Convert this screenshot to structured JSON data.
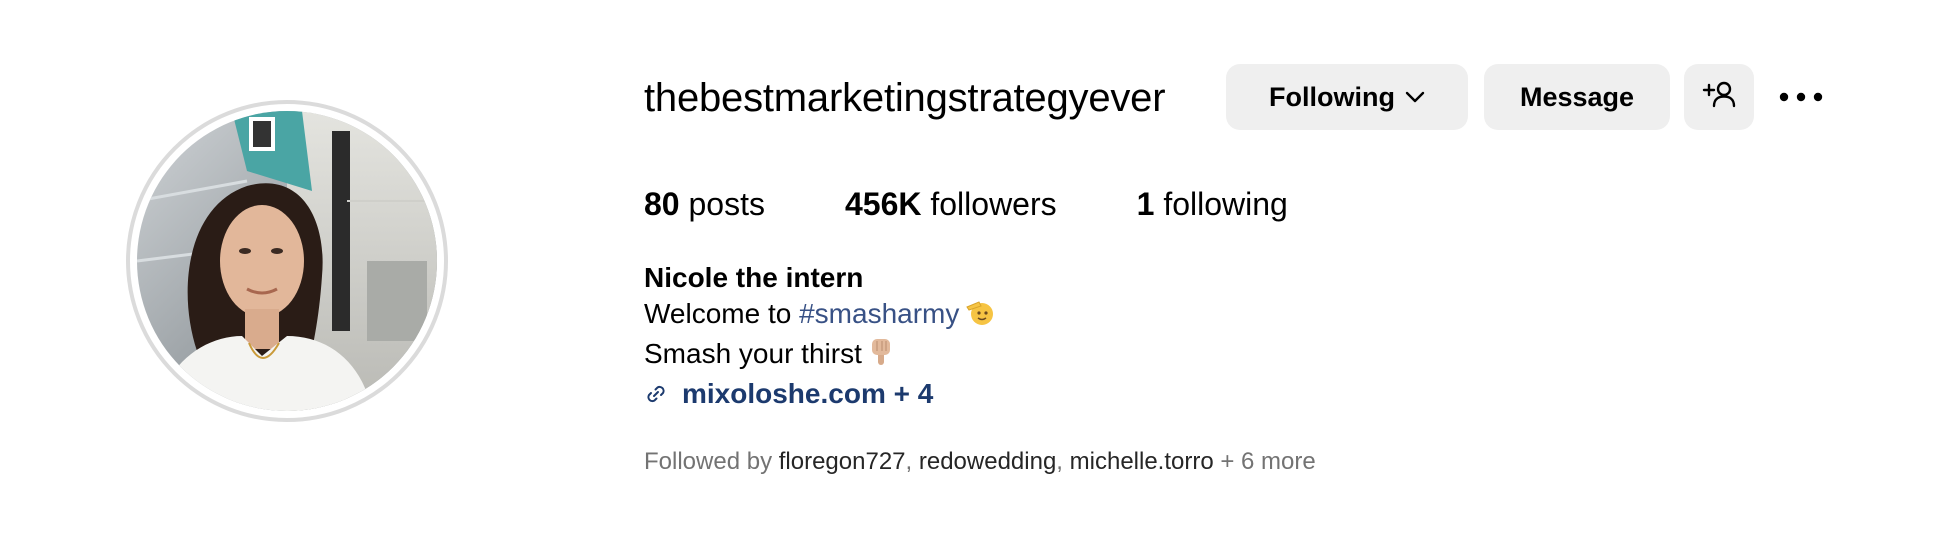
{
  "profile": {
    "username": "thebestmarketingstrategyever",
    "avatar_alt": "profile photo"
  },
  "actions": {
    "following_label": "Following",
    "message_label": "Message"
  },
  "stats": {
    "posts_count": "80",
    "posts_label": " posts",
    "followers_count": "456K",
    "followers_label": " followers",
    "following_count": "1",
    "following_label": " following"
  },
  "bio": {
    "name": "Nicole the intern",
    "line1_text": "Welcome to ",
    "line1_hashtag": "#smasharmy",
    "line2_text": "Smash your thirst",
    "link_text": "mixoloshe.com + 4"
  },
  "followed_by": {
    "prefix": "Followed by ",
    "users": [
      "floregon727",
      "redowedding",
      "michelle.torro"
    ],
    "more": " + 6 more"
  },
  "colors": {
    "button_bg": "#efefef",
    "hashtag": "#385185",
    "link": "#1c3a6e",
    "muted": "#737373",
    "avatar_ring": "#dbdbdb"
  }
}
